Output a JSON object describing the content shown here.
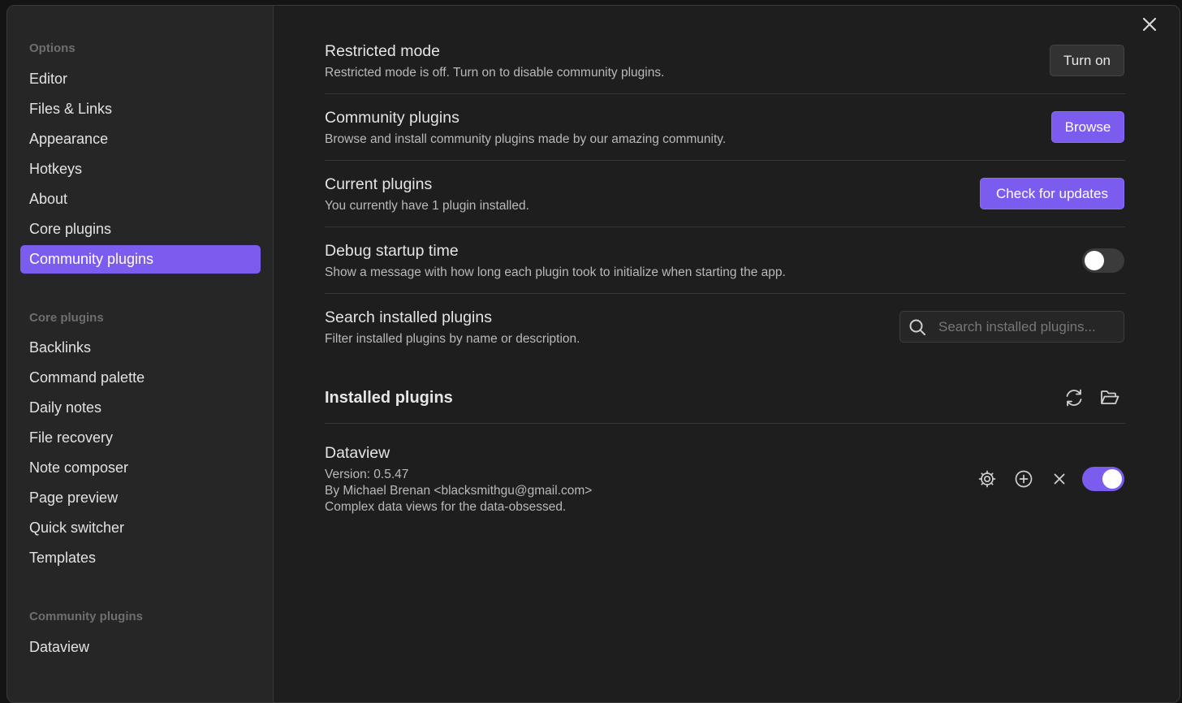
{
  "sidebar": {
    "options_heading": "Options",
    "options": [
      {
        "label": "Editor"
      },
      {
        "label": "Files & Links"
      },
      {
        "label": "Appearance"
      },
      {
        "label": "Hotkeys"
      },
      {
        "label": "About"
      },
      {
        "label": "Core plugins"
      },
      {
        "label": "Community plugins",
        "active": true
      }
    ],
    "core_heading": "Core plugins",
    "core": [
      {
        "label": "Backlinks"
      },
      {
        "label": "Command palette"
      },
      {
        "label": "Daily notes"
      },
      {
        "label": "File recovery"
      },
      {
        "label": "Note composer"
      },
      {
        "label": "Page preview"
      },
      {
        "label": "Quick switcher"
      },
      {
        "label": "Templates"
      }
    ],
    "community_heading": "Community plugins",
    "community": [
      {
        "label": "Dataview"
      }
    ]
  },
  "settings": {
    "restricted": {
      "name": "Restricted mode",
      "desc": "Restricted mode is off. Turn on to disable community plugins.",
      "button": "Turn on"
    },
    "community": {
      "name": "Community plugins",
      "desc": "Browse and install community plugins made by our amazing community.",
      "button": "Browse"
    },
    "current": {
      "name": "Current plugins",
      "desc": "You currently have 1 plugin installed.",
      "button": "Check for updates"
    },
    "debug": {
      "name": "Debug startup time",
      "desc": "Show a message with how long each plugin took to initialize when starting the app.",
      "enabled": false
    },
    "search": {
      "name": "Search installed plugins",
      "desc": "Filter installed plugins by name or description.",
      "placeholder": "Search installed plugins...",
      "value": ""
    }
  },
  "installed": {
    "title": "Installed plugins",
    "plugins": [
      {
        "name": "Dataview",
        "version": "Version: 0.5.47",
        "author": "By Michael Brenan <blacksmithgu@gmail.com>",
        "description": "Complex data views for the data-obsessed.",
        "enabled": true
      }
    ]
  },
  "colors": {
    "accent": "#7b5cef",
    "background": "#1e1e1e",
    "sidebar": "#262626"
  },
  "icons": {
    "close": "close-icon",
    "search": "search-icon",
    "reload": "reload-icon",
    "folder": "folder-open-icon",
    "settings": "gear-icon",
    "hotkeys": "plus-circle-icon",
    "uninstall": "x-icon"
  }
}
